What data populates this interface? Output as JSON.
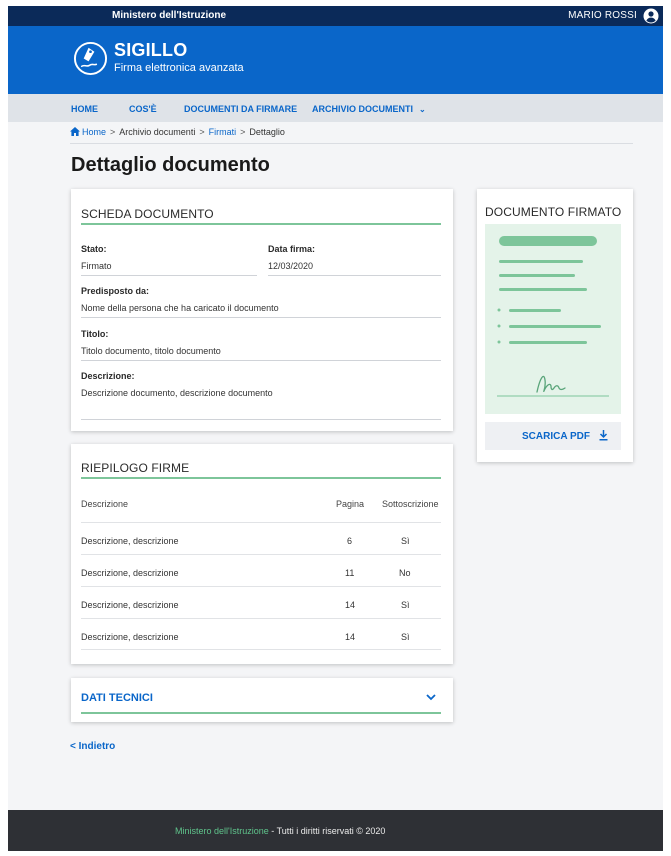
{
  "topbar": {
    "ministry": "Ministero dell'Istruzione",
    "user_name": "MARIO ROSSI",
    "user_icon": "user-circle-icon"
  },
  "brand": {
    "app_name": "SIGILLO",
    "subtitle": "Firma elettronica avanzata",
    "logo_icon": "pen-seal-icon"
  },
  "nav": {
    "items": [
      {
        "label": "HOME"
      },
      {
        "label": "COS'È"
      },
      {
        "label": "DOCUMENTI DA FIRMARE"
      },
      {
        "label": "ARCHIVIO DOCUMENTI"
      }
    ],
    "dropdown_icon": "chevron-down-icon"
  },
  "breadcrumb": {
    "home": "Home",
    "items": [
      "Archivio documenti",
      "Firmati",
      "Dettaglio"
    ],
    "separator": ">"
  },
  "page": {
    "title": "Dettaglio documento"
  },
  "scheda": {
    "title": "SCHEDA DOCUMENTO",
    "stato_label": "Stato:",
    "stato_value": "Firmato",
    "data_label": "Data firma:",
    "data_value": "12/03/2020",
    "predisposto_label": "Predisposto da:",
    "predisposto_value": "Nome della persona che ha caricato il documento",
    "titolo_label": "Titolo:",
    "titolo_value": "Titolo documento, titolo documento",
    "descrizione_label": "Descrizione:",
    "descrizione_value": "Descrizione documento, descrizione documento"
  },
  "documento": {
    "title": "DOCUMENTO FIRMATO",
    "download_label": "SCARICA PDF",
    "download_icon": "download-icon"
  },
  "firme": {
    "title": "RIEPILOGO FIRME",
    "columns": [
      "Descrizione",
      "Pagina",
      "Sottoscrizione"
    ],
    "rows": [
      [
        "Descrizione, descrizione",
        "6",
        "Sì"
      ],
      [
        "Descrizione, descrizione",
        "11",
        "No"
      ],
      [
        "Descrizione, descrizione",
        "14",
        "Sì"
      ],
      [
        "Descrizione, descrizione",
        "14",
        "Sì"
      ]
    ]
  },
  "tecnici": {
    "label": "DATI TECNICI",
    "icon": "chevron-down-icon"
  },
  "back": {
    "label": "< Indietro"
  },
  "footer": {
    "link": "Ministero dell'Istruzione",
    "text": " - Tutti i diritti riservati © 2020"
  },
  "colors": {
    "header_dark": "#0b2a59",
    "brand_blue": "#0a66c9",
    "accent_green": "#7dc59a",
    "footer_bg": "#2e3035"
  }
}
